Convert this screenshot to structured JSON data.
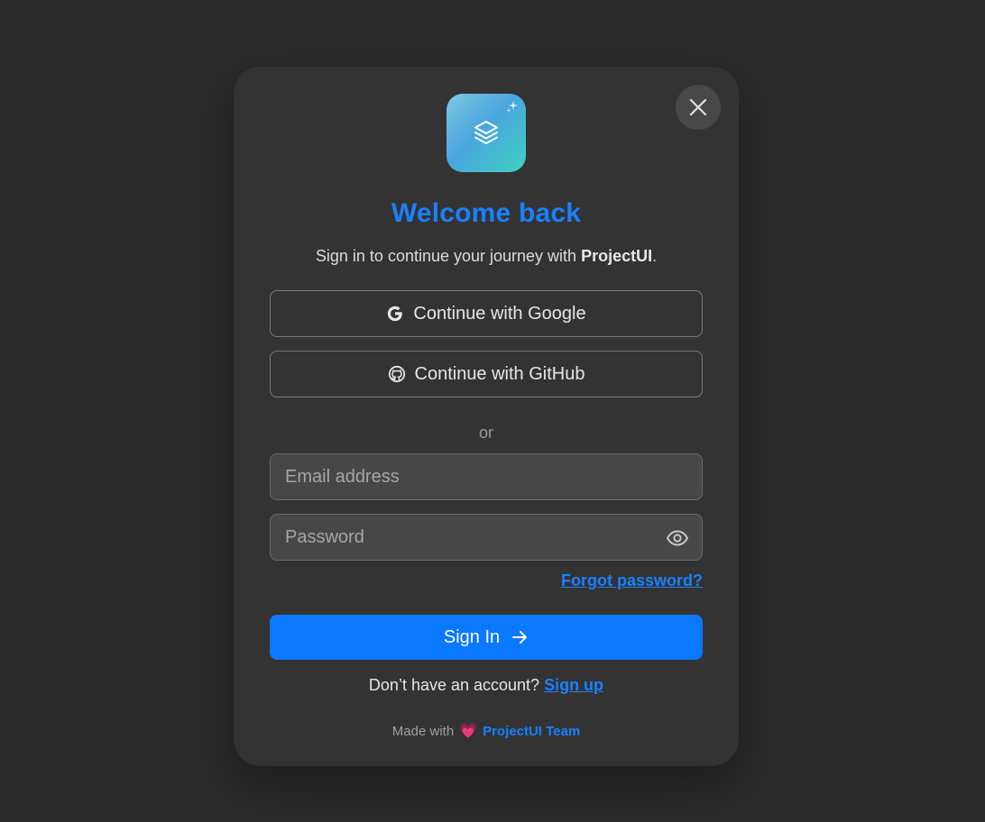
{
  "modal": {
    "title": "Welcome back",
    "subtitle_prefix": "Sign in to continue your journey with ",
    "subtitle_brand": "ProjectUI",
    "subtitle_suffix": ".",
    "logo_icon": "layers-icon",
    "close_icon": "close-icon"
  },
  "oauth": {
    "google_label": "Continue with Google",
    "github_label": "Continue with GitHub"
  },
  "divider": {
    "label": "or"
  },
  "form": {
    "email_placeholder": "Email address",
    "email_value": "",
    "password_placeholder": "Password",
    "password_value": "",
    "forgot_label": "Forgot password?",
    "submit_label": "Sign In"
  },
  "signup": {
    "prompt": "Don’t have an account? ",
    "link_label": "Sign up"
  },
  "footer": {
    "made_with": "Made with",
    "heart": "💗",
    "team": "ProjectUI Team"
  },
  "colors": {
    "accent": "#1a80ff",
    "button": "#0a78ff",
    "background": "#2b2b2b",
    "card": "#333333"
  }
}
